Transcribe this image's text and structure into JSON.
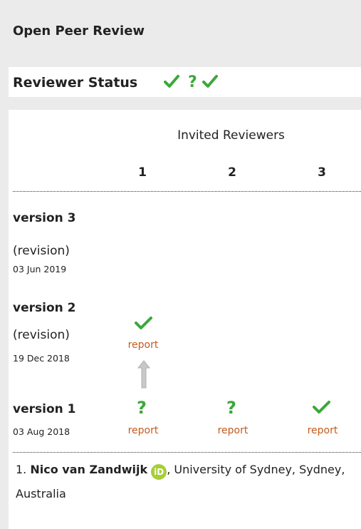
{
  "header": {
    "title": "Open Peer Review"
  },
  "status": {
    "label": "Reviewer Status",
    "icons": [
      "check-icon",
      "question-icon",
      "check-icon"
    ]
  },
  "table": {
    "heading": "Invited Reviewers",
    "columns": [
      "1",
      "2",
      "3"
    ],
    "versions": [
      {
        "label": "version 3",
        "note": "(revision)",
        "date": "03 Jun 2019"
      },
      {
        "label": "version 2",
        "note": "(revision)",
        "date": "19 Dec 2018",
        "reports": [
          {
            "col": 1,
            "status": "approved",
            "text": "report"
          }
        ]
      },
      {
        "label": "version 1",
        "date": "03 Aug 2018",
        "reports": [
          {
            "col": 1,
            "status": "approved-with-reservations",
            "text": "report"
          },
          {
            "col": 2,
            "status": "approved-with-reservations",
            "text": "report"
          },
          {
            "col": 3,
            "status": "approved",
            "text": "report"
          }
        ]
      }
    ]
  },
  "reviewers": [
    {
      "number": "1.",
      "name": "Nico van Zandwijk",
      "orcid_text": "iD",
      "affiliation": ", University of Sydney, Sydney, Australia"
    }
  ],
  "colors": {
    "approved": "#3aa83a",
    "reservations": "#3aa83a",
    "link": "#c65a1e"
  }
}
